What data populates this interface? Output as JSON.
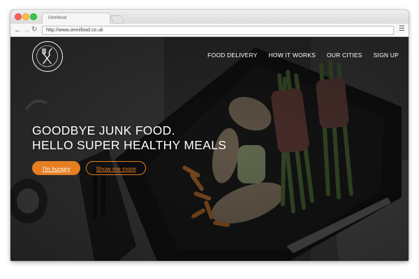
{
  "browser": {
    "tab_title": "Omnifood",
    "url": "http://www.omnifood.co.uk",
    "back_icon": "←",
    "forward_icon": "→",
    "reload_icon": "↻",
    "menu_icon": "☰"
  },
  "nav": {
    "items": [
      {
        "label": "FOOD DELIVERY"
      },
      {
        "label": "HOW IT WORKS"
      },
      {
        "label": "OUR CITIES"
      },
      {
        "label": "SIGN UP"
      }
    ]
  },
  "hero": {
    "headline_line1": "GOODBYE JUNK FOOD.",
    "headline_line2": "HELLO SUPER HEALTHY MEALS",
    "primary_button": "I'm hungry",
    "secondary_button": "Show me more"
  },
  "colors": {
    "accent": "#e67e22",
    "nav_text": "#ffffff",
    "overlay": "#2b2b2b"
  }
}
